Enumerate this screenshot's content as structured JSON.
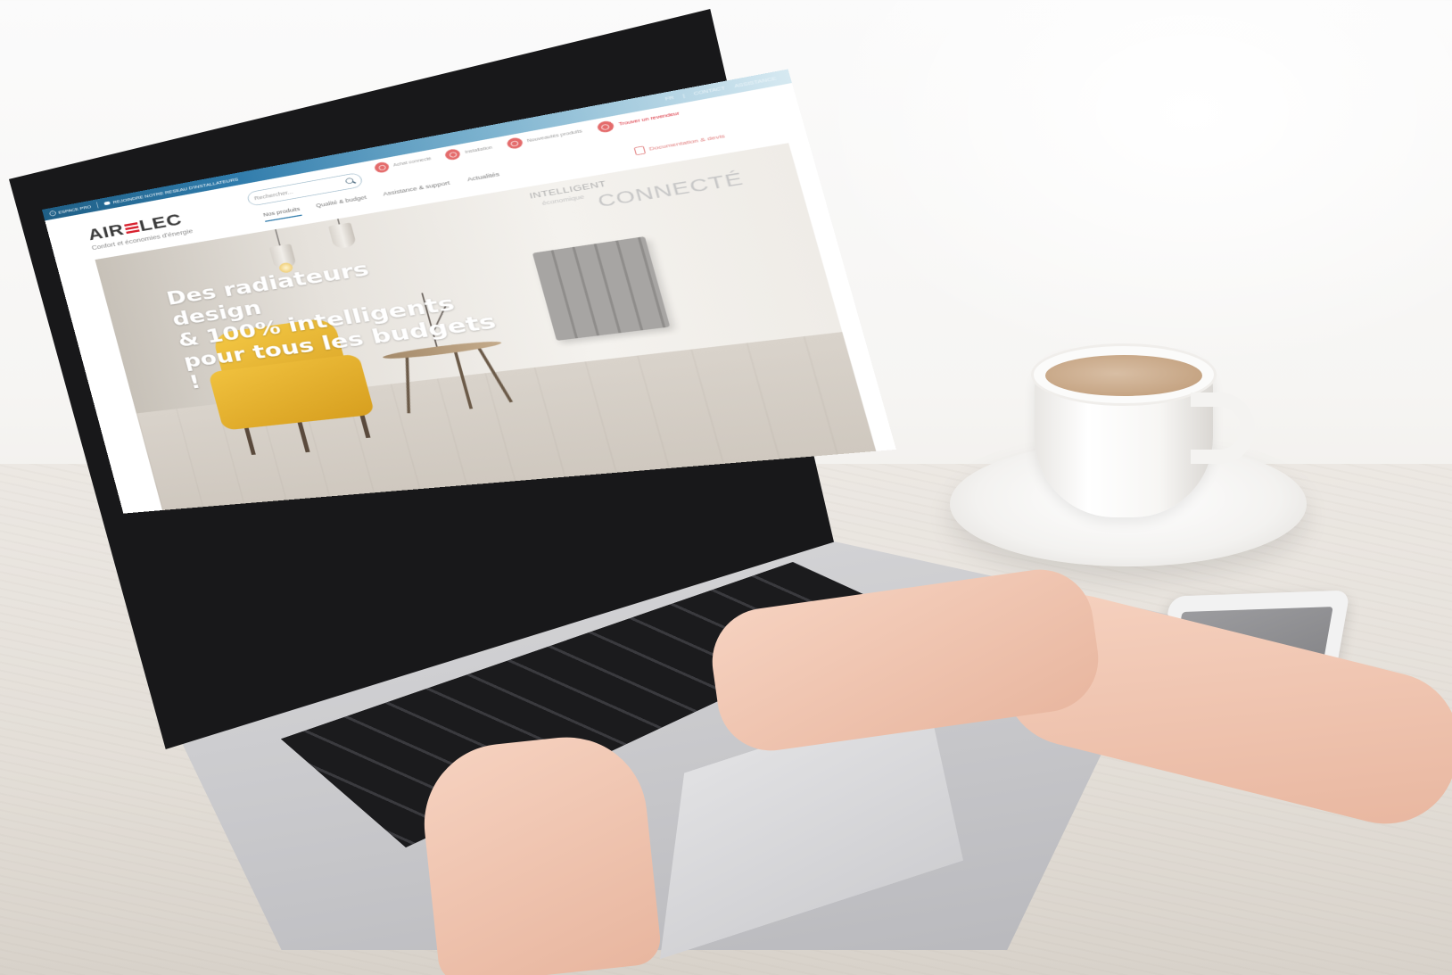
{
  "site": {
    "topbar": {
      "espace_pro": "ESPACE PRO",
      "rejoindre": "REJOINDRE NOTRE RESEAU D'INSTALLATEURS",
      "right_links": [
        "FR",
        "|",
        "CONTACT",
        "ASSISTANCE"
      ]
    },
    "logo": {
      "name": "AIRELEC",
      "tagline": "Confort et économies d'énergie"
    },
    "search": {
      "placeholder": "Rechercher..."
    },
    "features": [
      {
        "label": "Achat connecté",
        "icon": "pin-icon",
        "highlight": false
      },
      {
        "label": "Installation",
        "icon": "star-icon",
        "highlight": false
      },
      {
        "label": "Nouveautés produits",
        "icon": "gear-icon",
        "highlight": false
      },
      {
        "label": "Trouver un revendeur",
        "icon": "location-icon",
        "highlight": true
      }
    ],
    "nav": [
      {
        "label": "Nos produits",
        "active": true
      },
      {
        "label": "Qualité & budget",
        "active": false
      },
      {
        "label": "Assistance & support",
        "active": false
      },
      {
        "label": "Actualités",
        "active": false
      }
    ],
    "brochure": {
      "label": "Documentation & devis",
      "icon": "document-icon"
    },
    "hero": {
      "title": "Des radiateurs design\n& 100% intelligents\npour tous les budgets !",
      "badge_top": "INTELLIGENT",
      "badge_sub": "économique",
      "badge_main": "CONNECTÉ"
    }
  },
  "colors": {
    "brand_red": "#d8222f",
    "topbar_blue": "#2f7bab",
    "chair_yellow": "#e5ae2a"
  }
}
